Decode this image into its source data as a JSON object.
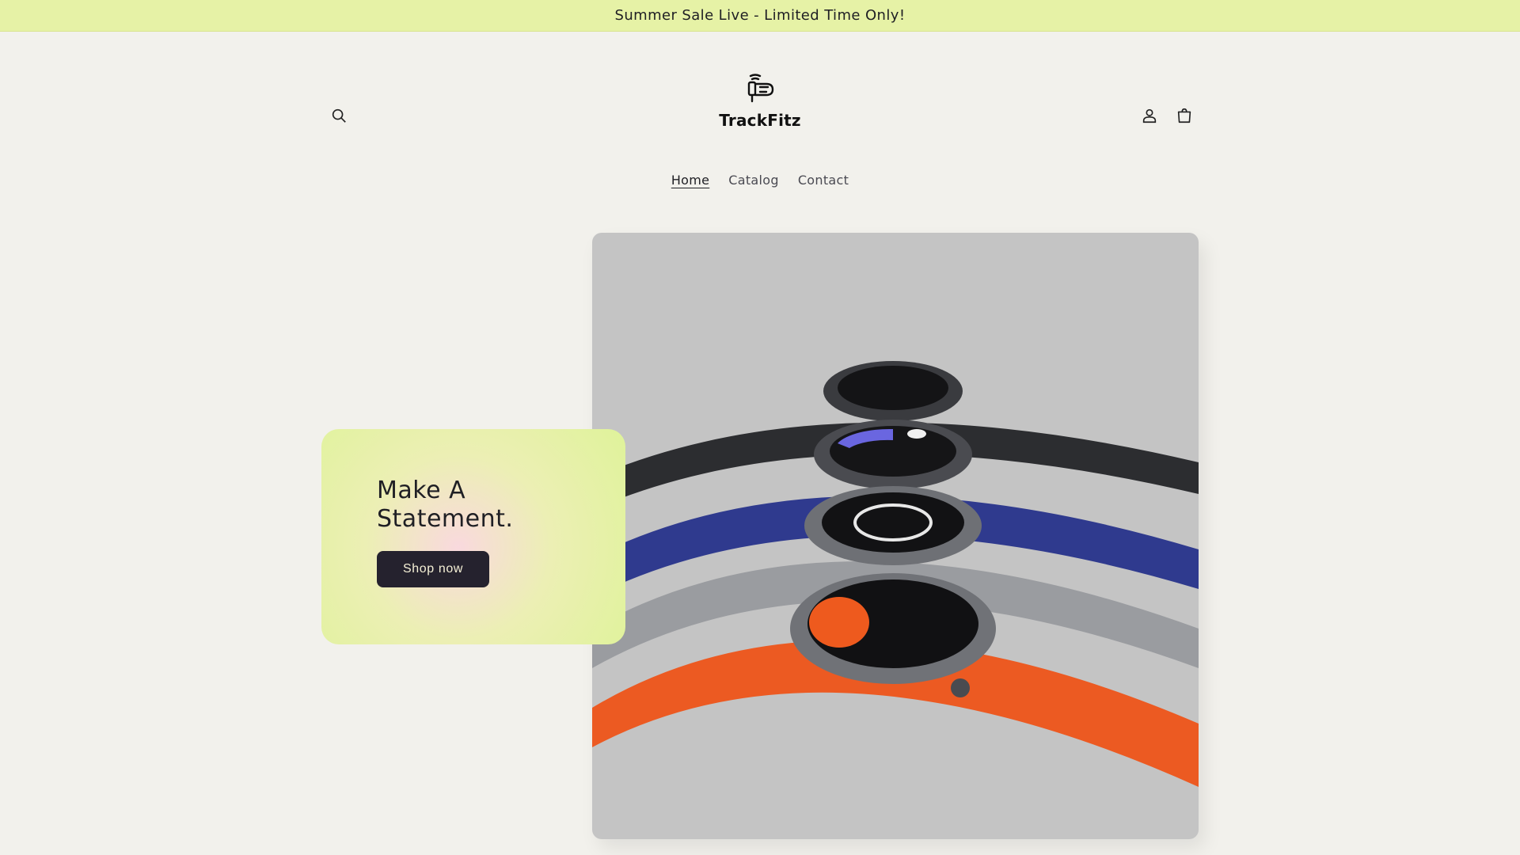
{
  "announcement": {
    "text": "Summer Sale Live - Limited Time Only!"
  },
  "header": {
    "logo_text": "TrackFitz",
    "icons": {
      "search": "search-icon",
      "account": "user-icon",
      "cart": "cart-icon"
    }
  },
  "nav": {
    "items": [
      {
        "label": "Home",
        "active": true
      },
      {
        "label": "Catalog",
        "active": false
      },
      {
        "label": "Contact",
        "active": false
      }
    ]
  },
  "hero": {
    "title": "Make A Statement.",
    "button_label": "Shop now"
  },
  "colors": {
    "announcement_bg": "#e6f2a6",
    "page_bg": "#f2f1ec",
    "button_bg": "#25222e",
    "button_text": "#f5f0d6"
  }
}
